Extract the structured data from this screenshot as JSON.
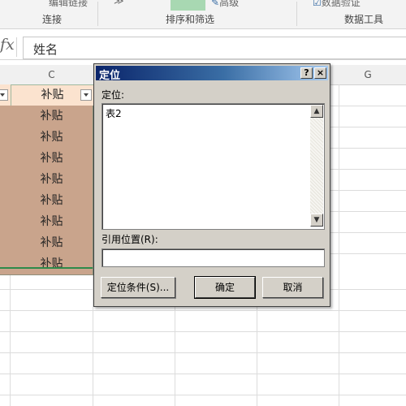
{
  "ribbon": {
    "groups": [
      "连接",
      "排序和筛选",
      "数据工具"
    ],
    "buttons": [
      "编辑链接",
      "高级",
      "数据验证"
    ]
  },
  "formula_bar": {
    "fx": "fx",
    "value": "姓名"
  },
  "grid": {
    "columns": [
      "C",
      "G"
    ],
    "header_cell": "补贴",
    "cells": [
      "补贴",
      "补贴",
      "补贴",
      "补贴",
      "补贴",
      "补贴",
      "补贴",
      "补贴"
    ],
    "colors": {
      "header_fill": "#fbe3cf",
      "data_fill": "#c9a48c"
    }
  },
  "dialog": {
    "title": "定位",
    "help_btn": "?",
    "close_btn": "×",
    "goto_label": "定位:",
    "list_items": [
      "表2"
    ],
    "ref_label": "引用位置(R):",
    "ref_value": "",
    "special_btn": "定位条件(S)...",
    "ok_btn": "确定",
    "cancel_btn": "取消"
  }
}
